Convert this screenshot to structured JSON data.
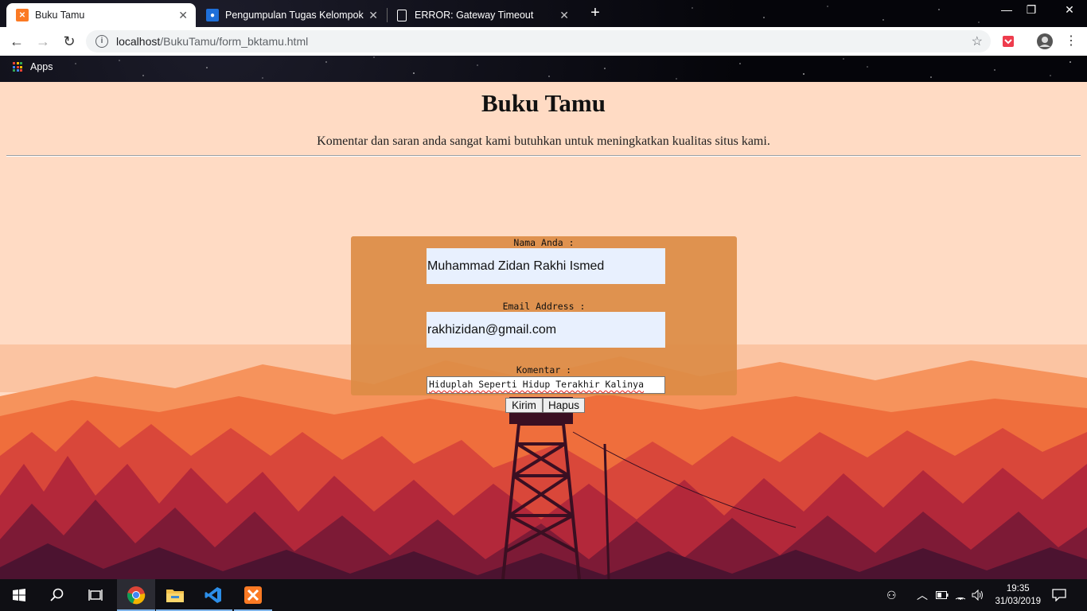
{
  "browser": {
    "tabs": [
      {
        "title": "Buku Tamu",
        "favicon": "xampp-icon",
        "active": true
      },
      {
        "title": "Pengumpulan Tugas Kelompok",
        "favicon": "classroom-icon",
        "active": false
      },
      {
        "title": "ERROR: Gateway Timeout",
        "favicon": "document-icon",
        "active": false
      }
    ],
    "url_host": "localhost",
    "url_path": "/BukuTamu/form_bktamu.html",
    "bookmarks_apps_label": "Apps"
  },
  "page": {
    "title": "Buku Tamu",
    "subtitle": "Komentar dan saran anda sangat kami butuhkan untuk meningkatkan kualitas situs kami.",
    "form": {
      "name_label": "Nama Anda :",
      "name_value": "Muhammad Zidan Rakhi Ismed",
      "email_label": "Email Address :",
      "email_value": "rakhizidan@gmail.com",
      "comment_label": "Komentar :",
      "comment_value": "Hiduplah Seperti Hidup Terakhir Kalinya",
      "submit_label": "Kirim",
      "reset_label": "Hapus"
    }
  },
  "taskbar": {
    "time": "19:35",
    "date": "31/03/2019",
    "apps": [
      "windows-start-icon",
      "search-icon",
      "task-view-icon",
      "chrome-icon",
      "file-explorer-icon",
      "vscode-icon",
      "xampp-icon"
    ]
  },
  "colors": {
    "page_background": "#ffdbc4",
    "form_panel": "#dd8c46",
    "input_autofill": "#e8f0fe"
  }
}
